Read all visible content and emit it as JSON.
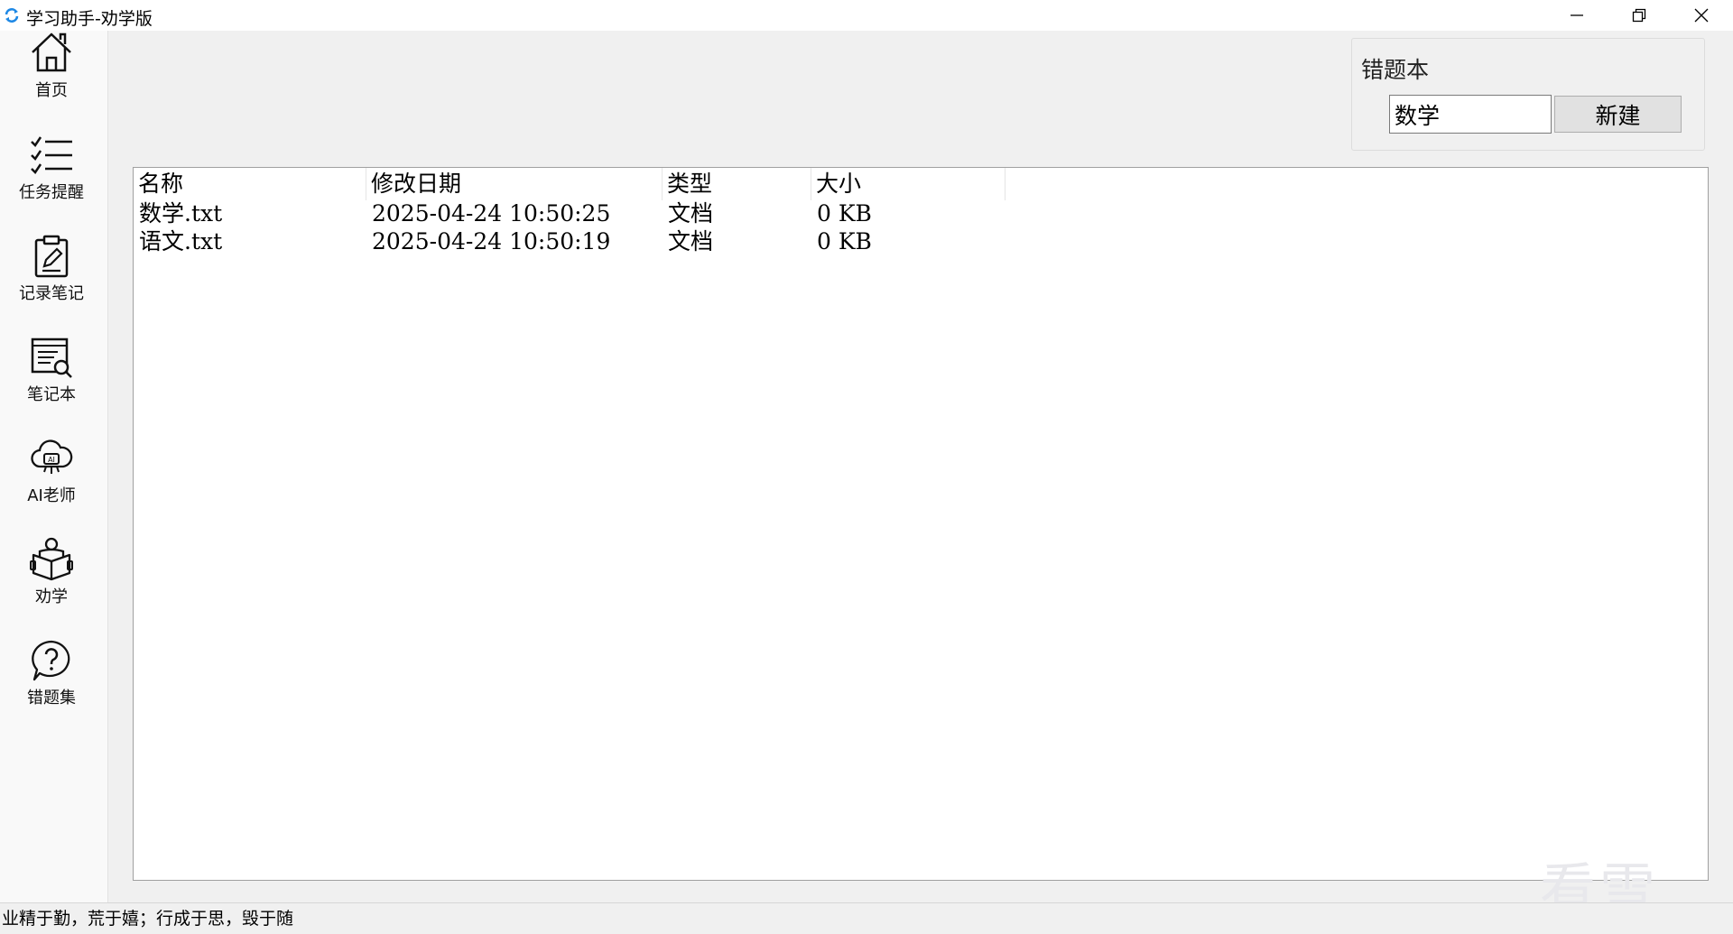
{
  "window": {
    "title": "学习助手-劝学版",
    "icon": "app-refresh-icon"
  },
  "sidebar": {
    "items": [
      {
        "label": "首页",
        "icon": "home-icon"
      },
      {
        "label": "任务提醒",
        "icon": "checklist-icon"
      },
      {
        "label": "记录笔记",
        "icon": "clipboard-edit-icon"
      },
      {
        "label": "笔记本",
        "icon": "notebook-search-icon"
      },
      {
        "label": "AI老师",
        "icon": "ai-cloud-icon"
      },
      {
        "label": "劝学",
        "icon": "reading-person-icon"
      },
      {
        "label": "错题集",
        "icon": "question-bubble-icon"
      }
    ]
  },
  "wrongbook": {
    "group_title": "错题本",
    "name_value": "数学",
    "new_button": "新建"
  },
  "file_list": {
    "columns": [
      "名称",
      "修改日期",
      "类型",
      "大小"
    ],
    "rows": [
      {
        "name": "数学.txt",
        "modified": "2025-04-24 10:50:25",
        "type": "文档",
        "size": "0 KB"
      },
      {
        "name": "语文.txt",
        "modified": "2025-04-24 10:50:19",
        "type": "文档",
        "size": "0 KB"
      }
    ]
  },
  "status": {
    "text": "业精于勤，荒于嬉；行成于思，毁于随"
  },
  "watermark": "看雪"
}
